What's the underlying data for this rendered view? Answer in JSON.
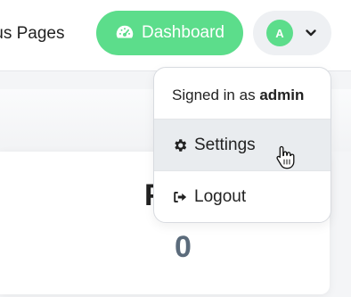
{
  "header": {
    "nav_link_label": "tus Pages",
    "dashboard_label": "Dashboard",
    "avatar_initial": "A"
  },
  "card": {
    "title_fragment": "P",
    "value": "0"
  },
  "dropdown": {
    "signed_in_prefix": "Signed in as",
    "username": "admin",
    "items": [
      {
        "label": "Settings",
        "icon": "gear-icon"
      },
      {
        "label": "Logout",
        "icon": "logout-icon"
      }
    ]
  },
  "colors": {
    "accent_green": "#5cdd8b",
    "muted_value": "#5b6b7b",
    "hover_bg": "#e9ecef"
  }
}
